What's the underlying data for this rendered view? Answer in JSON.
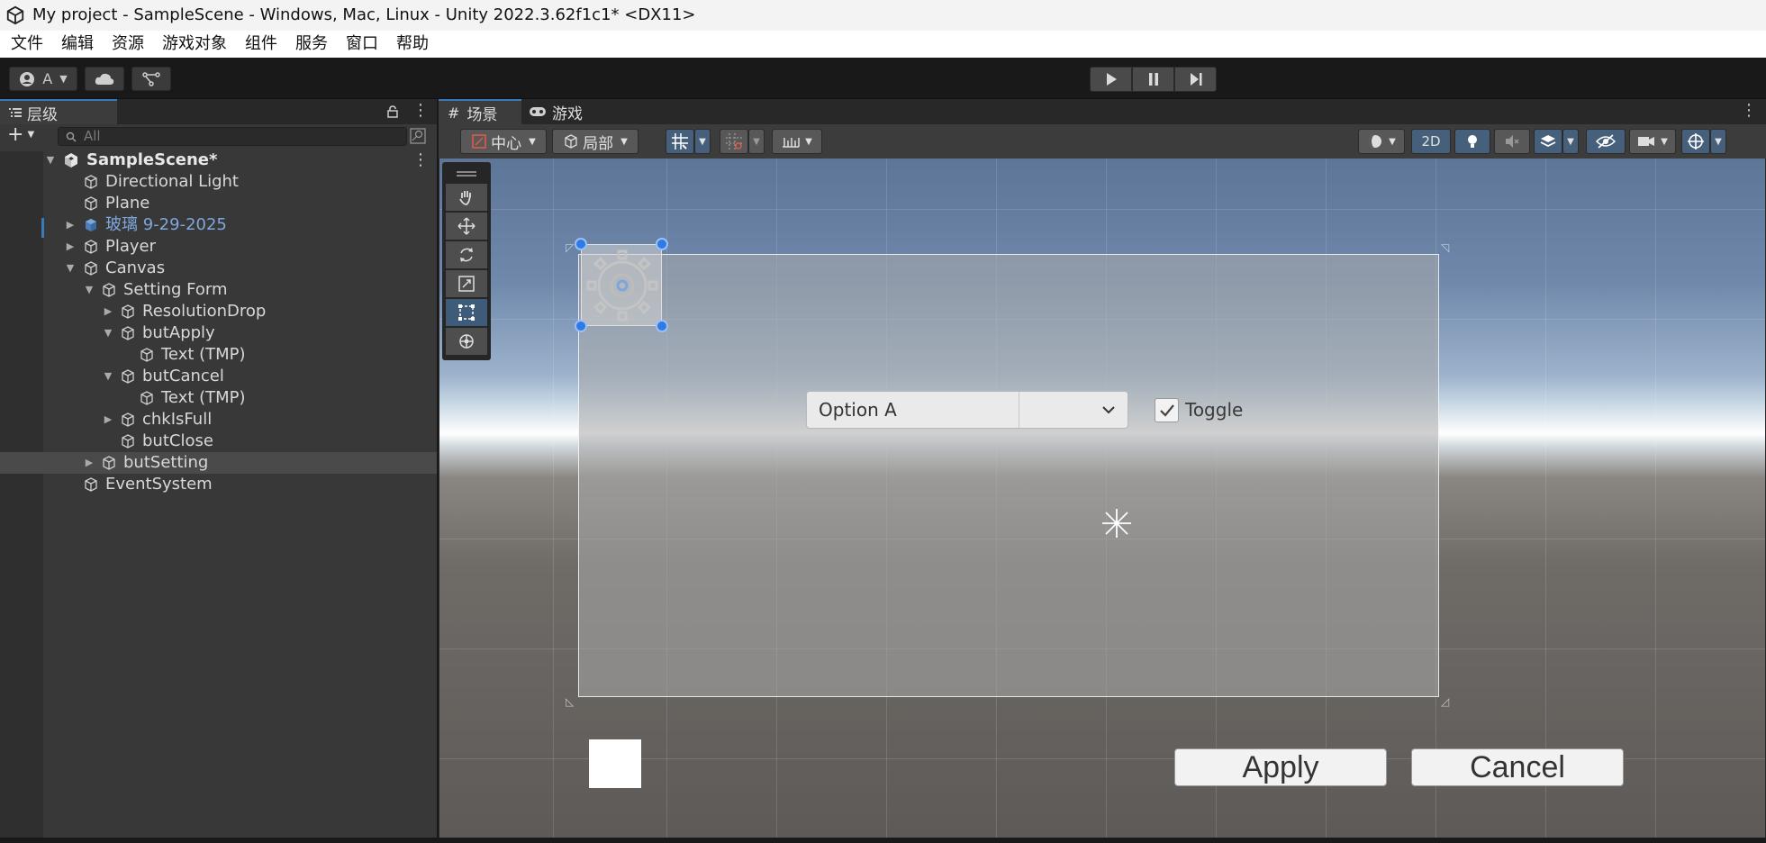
{
  "window": {
    "title": "My project - SampleScene - Windows, Mac, Linux - Unity 2022.3.62f1c1* <DX11>"
  },
  "menu": [
    "文件",
    "编辑",
    "资源",
    "游戏对象",
    "组件",
    "服务",
    "窗口",
    "帮助"
  ],
  "toolbar": {
    "account_label": "A"
  },
  "hierarchy": {
    "tab_label": "层级",
    "search_placeholder": "All",
    "scene_name": "SampleScene*",
    "items": [
      {
        "label": "Directional Light"
      },
      {
        "label": "Plane"
      },
      {
        "label": "玻璃 9-29-2025"
      },
      {
        "label": "Player"
      },
      {
        "label": "Canvas"
      },
      {
        "label": "Setting Form"
      },
      {
        "label": "ResolutionDrop"
      },
      {
        "label": "butApply"
      },
      {
        "label": "Text (TMP)"
      },
      {
        "label": "butCancel"
      },
      {
        "label": "Text (TMP)"
      },
      {
        "label": "chkIsFull"
      },
      {
        "label": "butClose"
      },
      {
        "label": "butSetting"
      },
      {
        "label": "EventSystem"
      }
    ]
  },
  "scene_view": {
    "tabs": [
      {
        "label": "场景"
      },
      {
        "label": "游戏"
      }
    ],
    "pivot_label": "中心",
    "space_label": "局部",
    "mode_2d_label": "2D"
  },
  "game_ui": {
    "dropdown_value": "Option A",
    "toggle_label": "Toggle",
    "apply_label": "Apply",
    "cancel_label": "Cancel"
  },
  "colors": {
    "selection_accent": "#3a79bb",
    "prefab_text": "#7ea7dd",
    "handle_blue": "#2f7ae5"
  }
}
